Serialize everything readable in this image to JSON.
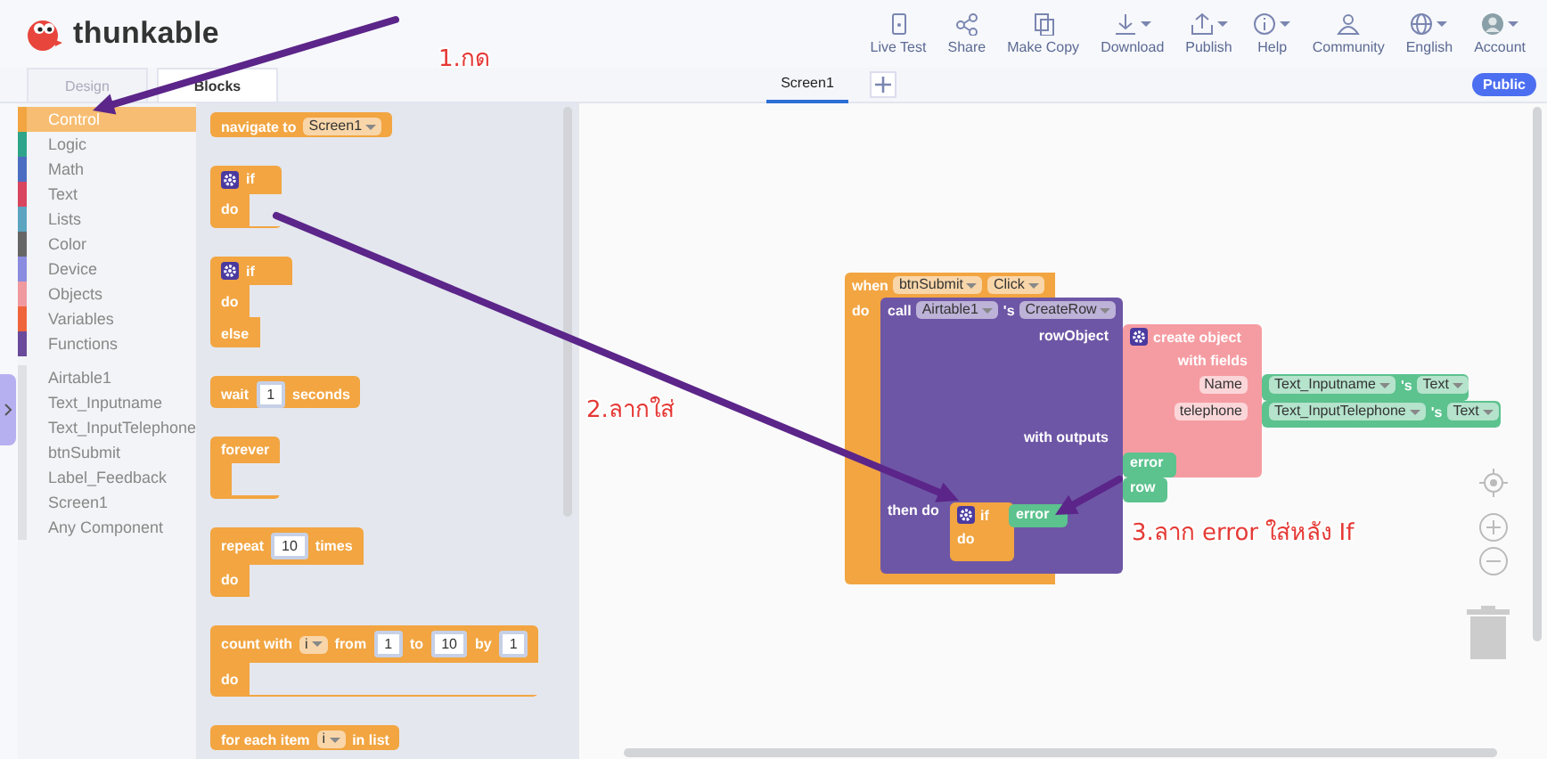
{
  "header": {
    "logo": "thunkable",
    "toolbar": [
      {
        "label": "Live Test",
        "dropdown": false
      },
      {
        "label": "Share",
        "dropdown": false
      },
      {
        "label": "Make Copy",
        "dropdown": false
      },
      {
        "label": "Download",
        "dropdown": true
      },
      {
        "label": "Publish",
        "dropdown": true
      },
      {
        "label": "Help",
        "dropdown": true
      },
      {
        "label": "Community",
        "dropdown": false
      },
      {
        "label": "English",
        "dropdown": true
      },
      {
        "label": "Account",
        "dropdown": true
      }
    ]
  },
  "mode_tabs": [
    {
      "label": "Design",
      "selected": false
    },
    {
      "label": "Blocks",
      "selected": true
    }
  ],
  "screen_tabs": [
    {
      "label": "Screen1",
      "selected": true
    }
  ],
  "badge": "Public",
  "categories": [
    {
      "label": "Control",
      "color": "#f2a541",
      "selected": true
    },
    {
      "label": "Logic",
      "color": "#2ea58a",
      "selected": false
    },
    {
      "label": "Math",
      "color": "#4c6ec2",
      "selected": false
    },
    {
      "label": "Text",
      "color": "#d9455f",
      "selected": false
    },
    {
      "label": "Lists",
      "color": "#5ba5c0",
      "selected": false
    },
    {
      "label": "Color",
      "color": "#666666",
      "selected": false
    },
    {
      "label": "Device",
      "color": "#8a8ce0",
      "selected": false
    },
    {
      "label": "Objects",
      "color": "#f09aa0",
      "selected": false
    },
    {
      "label": "Variables",
      "color": "#f0643c",
      "selected": false
    },
    {
      "label": "Functions",
      "color": "#6a4a9a",
      "selected": false
    }
  ],
  "components": [
    "Airtable1",
    "Text_Inputname",
    "Text_InputTelephone",
    "btnSubmit",
    "Label_Feedback",
    "Screen1",
    "Any Component"
  ],
  "flyout_blocks": [
    {
      "kind": "control",
      "rows": [
        {
          "parts": [
            {
              "kind": "label",
              "text": "navigate to"
            },
            {
              "kind": "dropdown",
              "text": "Screen1"
            }
          ]
        }
      ]
    },
    {
      "kind": "control",
      "rows": [
        {
          "parts": [
            {
              "kind": "gear"
            },
            {
              "kind": "label",
              "text": "if"
            }
          ]
        },
        {
          "parts": [
            {
              "kind": "label",
              "text": "do"
            }
          ],
          "mouth": true
        }
      ]
    },
    {
      "kind": "control",
      "rows": [
        {
          "parts": [
            {
              "kind": "gear"
            },
            {
              "kind": "label",
              "text": "if"
            }
          ]
        },
        {
          "parts": [
            {
              "kind": "label",
              "text": "do"
            }
          ],
          "mouth": true
        },
        {
          "parts": [
            {
              "kind": "label",
              "text": "else"
            }
          ],
          "mouth": true
        }
      ]
    },
    {
      "kind": "control",
      "rows": [
        {
          "parts": [
            {
              "kind": "label",
              "text": "wait"
            },
            {
              "kind": "number",
              "text": "1"
            },
            {
              "kind": "label",
              "text": "seconds"
            }
          ]
        }
      ]
    },
    {
      "kind": "control",
      "rows": [
        {
          "parts": [
            {
              "kind": "label",
              "text": "forever"
            }
          ]
        },
        {
          "parts": [],
          "mouth": true
        }
      ]
    },
    {
      "kind": "control",
      "rows": [
        {
          "parts": [
            {
              "kind": "label",
              "text": "repeat"
            },
            {
              "kind": "number",
              "text": "10"
            },
            {
              "kind": "label",
              "text": "times"
            }
          ]
        },
        {
          "parts": [
            {
              "kind": "label",
              "text": "do"
            }
          ],
          "mouth": true
        }
      ]
    },
    {
      "kind": "control",
      "rows": [
        {
          "parts": [
            {
              "kind": "label",
              "text": "count with"
            },
            {
              "kind": "dropdown",
              "text": "i"
            },
            {
              "kind": "label",
              "text": "from"
            },
            {
              "kind": "number",
              "text": "1"
            },
            {
              "kind": "label",
              "text": "to"
            },
            {
              "kind": "number",
              "text": "10"
            },
            {
              "kind": "label",
              "text": "by"
            },
            {
              "kind": "number",
              "text": "1"
            }
          ]
        },
        {
          "parts": [
            {
              "kind": "label",
              "text": "do"
            }
          ],
          "mouth": true
        }
      ]
    },
    {
      "kind": "control",
      "rows": [
        {
          "parts": [
            {
              "kind": "label",
              "text": "for each item"
            },
            {
              "kind": "dropdown",
              "text": "i"
            },
            {
              "kind": "label",
              "text": "in list"
            }
          ]
        }
      ]
    }
  ],
  "workspace_blocks": [
    {
      "kind": "event",
      "rows": [
        {
          "parts": [
            {
              "kind": "label",
              "text": "when"
            },
            {
              "kind": "dropdown",
              "text": "btnSubmit"
            },
            {
              "kind": "dropdown",
              "text": "Click"
            }
          ]
        },
        {
          "parts": [
            {
              "kind": "label",
              "text": "do"
            }
          ]
        }
      ]
    },
    {
      "kind": "method",
      "rows": [
        {
          "parts": [
            {
              "kind": "label",
              "text": "call"
            },
            {
              "kind": "dropdown",
              "text": "Airtable1"
            },
            {
              "kind": "label",
              "text": "'s"
            },
            {
              "kind": "dropdown",
              "text": "CreateRow"
            }
          ]
        },
        {
          "parts": [
            {
              "kind": "label",
              "text": "rowObject"
            }
          ]
        },
        {
          "parts": [
            {
              "kind": "label",
              "text": "with outputs"
            }
          ]
        },
        {
          "parts": [
            {
              "kind": "label",
              "text": "then do"
            }
          ]
        }
      ]
    },
    {
      "kind": "object",
      "rows": [
        {
          "parts": [
            {
              "kind": "gear"
            },
            {
              "kind": "label",
              "text": "create object"
            }
          ]
        },
        {
          "parts": [
            {
              "kind": "label",
              "text": "with fields"
            }
          ]
        },
        {
          "parts": [
            {
              "kind": "field",
              "text": "Name"
            }
          ]
        },
        {
          "parts": [
            {
              "kind": "field",
              "text": "telephone"
            }
          ]
        }
      ]
    },
    {
      "kind": "getter",
      "rows": [
        {
          "parts": [
            {
              "kind": "dropdown",
              "text": "Text_Inputname"
            },
            {
              "kind": "label",
              "text": "'s"
            },
            {
              "kind": "dropdown",
              "text": "Text"
            }
          ]
        }
      ]
    },
    {
      "kind": "getter",
      "rows": [
        {
          "parts": [
            {
              "kind": "dropdown",
              "text": "Text_InputTelephone"
            },
            {
              "kind": "label",
              "text": "'s"
            },
            {
              "kind": "dropdown",
              "text": "Text"
            }
          ]
        }
      ]
    },
    {
      "kind": "output",
      "rows": [
        {
          "parts": [
            {
              "kind": "label",
              "text": "error"
            }
          ]
        }
      ]
    },
    {
      "kind": "output",
      "rows": [
        {
          "parts": [
            {
              "kind": "label",
              "text": "row"
            }
          ]
        }
      ]
    },
    {
      "kind": "control",
      "rows": [
        {
          "parts": [
            {
              "kind": "gear"
            },
            {
              "kind": "label",
              "text": "if"
            }
          ]
        },
        {
          "parts": [
            {
              "kind": "label",
              "text": "do"
            }
          ]
        }
      ]
    },
    {
      "kind": "output",
      "rows": [
        {
          "parts": [
            {
              "kind": "label",
              "text": "error"
            }
          ]
        }
      ]
    }
  ],
  "annotations": [
    {
      "text": "1.กด"
    },
    {
      "text": "2.ลากใส่"
    },
    {
      "text": "3.ลาก error ใส่หลัง If"
    }
  ]
}
